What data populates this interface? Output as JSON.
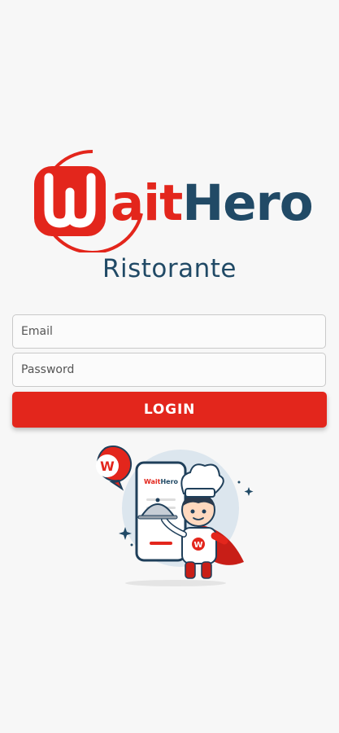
{
  "brand": {
    "logo_text": "WaitHero",
    "subtitle": "Ristorante",
    "primary_color": "#e3261c",
    "secondary_color": "#214a66"
  },
  "form": {
    "email_placeholder": "Email",
    "password_placeholder": "Password",
    "login_label": "LOGIN"
  },
  "illustration": {
    "phone_logo_text": "WaitHero",
    "icon": "chef-hero-illustration"
  }
}
